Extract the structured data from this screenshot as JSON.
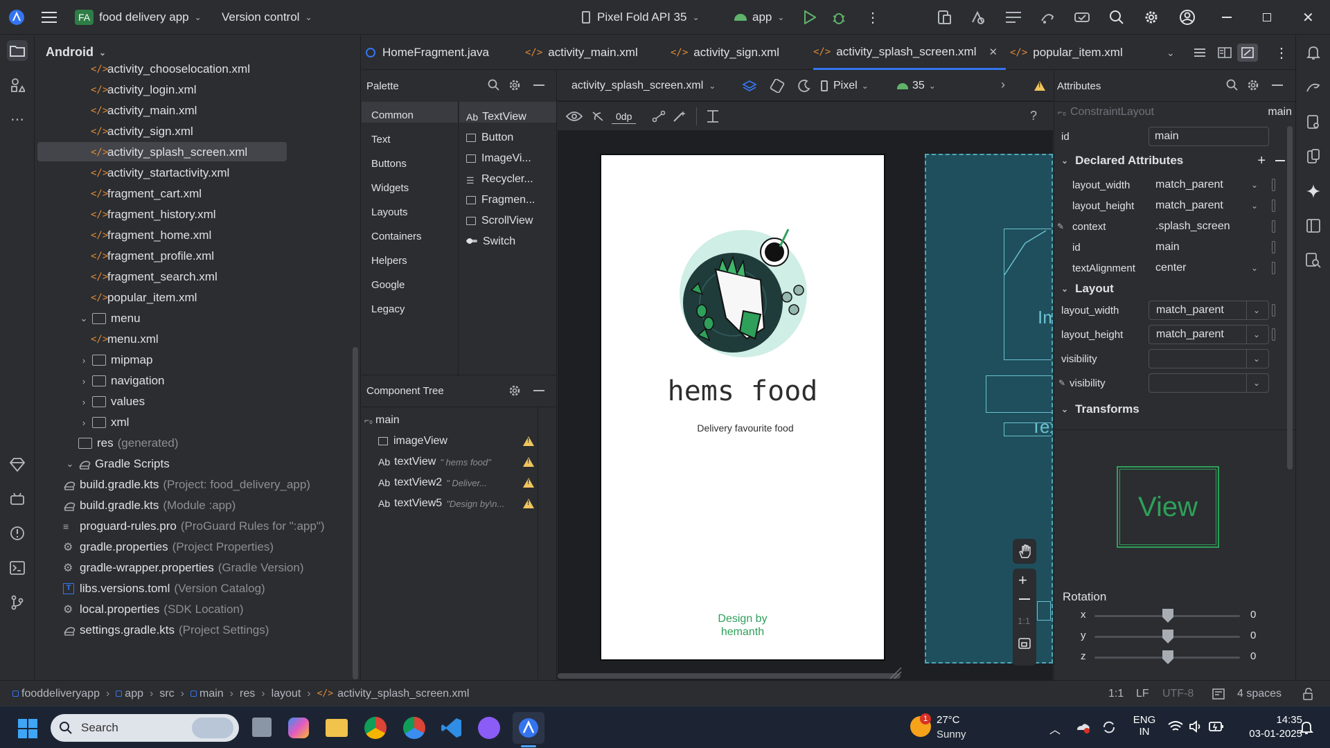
{
  "title_bar": {
    "project_badge": "FA",
    "project_name": "food delivery app",
    "vcs": "Version control",
    "device": "Pixel Fold API 35",
    "run_config": "app"
  },
  "project_panel": {
    "view_mode": "Android",
    "rows": [
      {
        "label": "activity_chooselocation.xml",
        "secondary": "",
        "type": "xml",
        "indent": 3
      },
      {
        "label": "activity_login.xml",
        "secondary": "",
        "type": "xml",
        "indent": 3
      },
      {
        "label": "activity_main.xml",
        "secondary": "",
        "type": "xml",
        "indent": 3
      },
      {
        "label": "activity_sign.xml",
        "secondary": "",
        "type": "xml",
        "indent": 3
      },
      {
        "label": "activity_splash_screen.xml",
        "secondary": "",
        "type": "xml",
        "indent": 3,
        "selected": true
      },
      {
        "label": "activity_startactivity.xml",
        "secondary": "",
        "type": "xml",
        "indent": 3
      },
      {
        "label": "fragment_cart.xml",
        "secondary": "",
        "type": "xml",
        "indent": 3
      },
      {
        "label": "fragment_history.xml",
        "secondary": "",
        "type": "xml",
        "indent": 3
      },
      {
        "label": "fragment_home.xml",
        "secondary": "",
        "type": "xml",
        "indent": 3
      },
      {
        "label": "fragment_profile.xml",
        "secondary": "",
        "type": "xml",
        "indent": 3
      },
      {
        "label": "fragment_search.xml",
        "secondary": "",
        "type": "xml",
        "indent": 3
      },
      {
        "label": "popular_item.xml",
        "secondary": "",
        "type": "xml",
        "indent": 3
      },
      {
        "label": "menu",
        "secondary": "",
        "type": "folder-open",
        "indent": 2
      },
      {
        "label": "menu.xml",
        "secondary": "",
        "type": "xml",
        "indent": 3
      },
      {
        "label": "mipmap",
        "secondary": "",
        "type": "folder",
        "indent": 2
      },
      {
        "label": "navigation",
        "secondary": "",
        "type": "folder",
        "indent": 2
      },
      {
        "label": "values",
        "secondary": "",
        "type": "folder",
        "indent": 2
      },
      {
        "label": "xml",
        "secondary": "",
        "type": "folder",
        "indent": 2
      },
      {
        "label": "res",
        "secondary": "(generated)",
        "type": "folder-leaf",
        "indent": 1
      },
      {
        "label": "Gradle Scripts",
        "secondary": "",
        "type": "gradle-open",
        "indent": 0
      },
      {
        "label": "build.gradle.kts",
        "secondary": "(Project: food_delivery_app)",
        "type": "gradle",
        "indent": 1
      },
      {
        "label": "build.gradle.kts",
        "secondary": "(Module :app)",
        "type": "gradle",
        "indent": 1
      },
      {
        "label": "proguard-rules.pro",
        "secondary": "(ProGuard Rules for \":app\")",
        "type": "lines",
        "indent": 1
      },
      {
        "label": "gradle.properties",
        "secondary": "(Project Properties)",
        "type": "gear",
        "indent": 1
      },
      {
        "label": "gradle-wrapper.properties",
        "secondary": "(Gradle Version)",
        "type": "gear",
        "indent": 1
      },
      {
        "label": "libs.versions.toml",
        "secondary": "(Version Catalog)",
        "type": "toml",
        "indent": 1
      },
      {
        "label": "local.properties",
        "secondary": "(SDK Location)",
        "type": "gear",
        "indent": 1
      },
      {
        "label": "settings.gradle.kts",
        "secondary": "(Project Settings)",
        "type": "gradle",
        "indent": 1
      }
    ]
  },
  "editor_tabs": [
    {
      "label": "HomeFragment.java",
      "kind": "java"
    },
    {
      "label": "activity_main.xml",
      "kind": "xml"
    },
    {
      "label": "activity_sign.xml",
      "kind": "xml"
    },
    {
      "label": "activity_splash_screen.xml",
      "kind": "xml",
      "active": true
    },
    {
      "label": "popular_item.xml",
      "kind": "xml"
    }
  ],
  "palette": {
    "title": "Palette",
    "categories": [
      "Common",
      "Text",
      "Buttons",
      "Widgets",
      "Layouts",
      "Containers",
      "Helpers",
      "Google",
      "Legacy"
    ],
    "items": [
      {
        "prefix": "Ab",
        "label": "TextView"
      },
      {
        "prefix": "",
        "label": "Button"
      },
      {
        "prefix": "",
        "label": "ImageVi..."
      },
      {
        "prefix": "",
        "label": "Recycler..."
      },
      {
        "prefix": "",
        "label": "Fragmen..."
      },
      {
        "prefix": "",
        "label": "ScrollView"
      },
      {
        "prefix": "",
        "label": "Switch"
      }
    ]
  },
  "component_tree": {
    "title": "Component Tree",
    "root": "main",
    "nodes": [
      {
        "prefix": "",
        "label": "imageView",
        "hint": ""
      },
      {
        "prefix": "Ab",
        "label": "textView",
        "hint": "\" hems food\""
      },
      {
        "prefix": "Ab",
        "label": "textView2",
        "hint": "\"         Deliver..."
      },
      {
        "prefix": "Ab",
        "label": "textView5",
        "hint": "\"Design by\\n..."
      }
    ]
  },
  "design_toolbar": {
    "file": "activity_splash_screen.xml",
    "device": "Pixel",
    "api": "35",
    "margin": "0dp"
  },
  "phone_preview": {
    "title": "hems food",
    "subtitle": "Delivery favourite food",
    "credit_line1": "Design by",
    "credit_line2": "hemanth"
  },
  "blueprint": {
    "img_label": "Ima",
    "text_label": "Tex"
  },
  "zoom_controls": {
    "one_to_one": "1:1"
  },
  "attributes": {
    "title": "Attributes",
    "component": "ConstraintLayout",
    "component_id": "main",
    "id_label": "id",
    "id_value": "main",
    "declared_title": "Declared Attributes",
    "declared": [
      {
        "name": "layout_width",
        "value": "match_parent",
        "dropdown": true
      },
      {
        "name": "layout_height",
        "value": "match_parent",
        "dropdown": true
      },
      {
        "name": "context",
        "value": ".splash_screen",
        "dropdown": false
      },
      {
        "name": "id",
        "value": "main",
        "dropdown": false
      },
      {
        "name": "textAlignment",
        "value": "center",
        "dropdown": true
      }
    ],
    "layout_title": "Layout",
    "layout": [
      {
        "name": "layout_width",
        "value": "match_parent"
      },
      {
        "name": "layout_height",
        "value": "match_parent"
      },
      {
        "name": "visibility",
        "value": ""
      },
      {
        "name": "visibility",
        "value": ""
      }
    ],
    "transforms_title": "Transforms",
    "view_preview": "View",
    "rotation_title": "Rotation",
    "rotation": [
      {
        "axis": "x",
        "value": "0"
      },
      {
        "axis": "y",
        "value": "0"
      },
      {
        "axis": "z",
        "value": "0"
      }
    ]
  },
  "breadcrumbs": [
    "fooddeliveryapp",
    "app",
    "src",
    "main",
    "res",
    "layout",
    "activity_splash_screen.xml"
  ],
  "status": {
    "position": "1:1",
    "line_sep": "LF",
    "encoding": "UTF-8",
    "indent": "4 spaces"
  },
  "taskbar": {
    "search": "Search",
    "weather_temp": "27°C",
    "weather_desc": "Sunny",
    "weather_badge": "1",
    "lang1": "ENG",
    "lang2": "IN",
    "time": "14:35",
    "date": "03-01-2025"
  },
  "colors": {
    "accent": "#3574f0",
    "warning": "#f2c55c",
    "xml_icon": "#e08b3b",
    "preview_green": "#2ea05a",
    "blueprint": "#1f4f5c"
  }
}
